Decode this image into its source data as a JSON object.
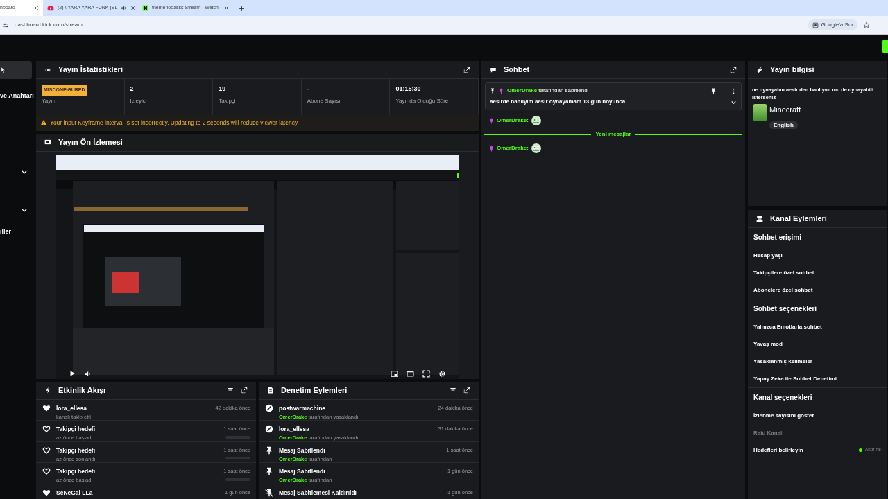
{
  "browser": {
    "tabs": [
      {
        "title": "hboard",
        "kind": "plain",
        "selected": true
      },
      {
        "title": "(2) //YARA YARA FUNK (SL",
        "kind": "video",
        "selected": false
      },
      {
        "title": "themeriodasss Stream - Watch",
        "kind": "kick",
        "selected": false
      }
    ],
    "url": "dashboard.kick.com/stream",
    "lens_button": "Google'a Sor"
  },
  "sidebar": {
    "items": [
      {
        "kind": "blank",
        "selected": true
      },
      {
        "kind": "text",
        "label": "ve Anahtarı",
        "selected": false
      },
      {
        "kind": "chevron",
        "selected": false
      },
      {
        "kind": "chevron",
        "selected": false
      },
      {
        "kind": "text",
        "label": "iller",
        "selected": false
      }
    ]
  },
  "stats": {
    "title": "Yayın İstatistikleri",
    "status_badge": "MISCONFIGURED",
    "items": [
      {
        "label": "Yayın"
      },
      {
        "value": "2",
        "label": "İzleyici"
      },
      {
        "value": "19",
        "label": "Takipçi"
      },
      {
        "value": "-",
        "label": "Abone Sayısı"
      },
      {
        "value": "01:15:30",
        "label": "Yayında Olduğu Süre"
      }
    ],
    "warning": "Your input Keyframe interval is set incorrectly. Updating to 2 seconds will reduce viewer latency."
  },
  "preview": {
    "title": "Yayın Ön İzlemesi"
  },
  "activity": {
    "title": "Etkinlik Akışı",
    "items": [
      {
        "kind": "follow",
        "title": "lora_ellesa",
        "subtitle": "kanalı takip etti",
        "time": "42 dakika önce"
      },
      {
        "kind": "goal",
        "title": "Takipçi hedefi",
        "subtitle": "az önce başladı",
        "time": "1 saat önce",
        "level": 0
      },
      {
        "kind": "goal",
        "title": "Takipçi hedefi",
        "subtitle": "az önce sonlandı",
        "time": "1 saat önce",
        "level": 0
      },
      {
        "kind": "goal",
        "title": "Takipçi hedefi",
        "subtitle": "az önce başladı",
        "time": "1 saat önce",
        "level": 0
      },
      {
        "kind": "follow",
        "title": "SeNeGal LLa",
        "time": "1 gün önce"
      }
    ]
  },
  "moderation": {
    "title": "Denetim Eylemleri",
    "items": [
      {
        "kind": "ban",
        "title": "postwarmachine",
        "actor": "OmerDrake",
        "detail": "tarafından yasaklandı",
        "time": "24 dakika önce"
      },
      {
        "kind": "ban",
        "title": "lora_ellesa",
        "actor": "OmerDrake",
        "detail": "tarafından yasaklandı",
        "time": "31 dakika önce"
      },
      {
        "kind": "pin",
        "title": "Mesaj Sabitlendi",
        "actor": "OmerDrake",
        "detail": "tarafından",
        "time": "1 saat önce"
      },
      {
        "kind": "pin",
        "title": "Mesaj Sabitlendi",
        "actor": "OmerDrake",
        "detail": "tarafından",
        "time": "1 gün önce"
      },
      {
        "kind": "unpin",
        "title": "Mesaj Sabitlemesi Kaldırıldı",
        "time": "1 gün önce"
      }
    ]
  },
  "chat": {
    "title": "Sohbet",
    "pinned": {
      "user": "OmerDrake",
      "suffix": "tarafından sabitlendi",
      "text": "aesirde banlıyım aesir oynayamam 13 gün boyunca"
    },
    "messages": [
      {
        "kind": "message",
        "user": "OmerDrake:"
      },
      {
        "kind": "divider",
        "label": "Yeni mesajlar"
      },
      {
        "kind": "message",
        "user": "OmerDrake:"
      }
    ]
  },
  "info": {
    "title": "Yayın bilgisi",
    "description_lines": [
      "ne oynayalım aesir den banlıyım mc de oynayabili",
      "isterseniz"
    ],
    "category": "Minecraft",
    "language": "English"
  },
  "actions": {
    "title": "Kanal Eylemleri",
    "sections": [
      {
        "heading": "Sohbet erişimi",
        "items": [
          {
            "label": "Hesap yaşı",
            "disabled": false
          },
          {
            "label": "Takipçilere özel sohbet",
            "disabled": false
          },
          {
            "label": "Abonelere özel sohbet",
            "disabled": false
          }
        ]
      },
      {
        "heading": "Sohbet seçenekleri",
        "items": [
          {
            "label": "Yalnızca Emotlarla sohbet",
            "disabled": false
          },
          {
            "label": "Yavaş mod",
            "disabled": false
          },
          {
            "label": "Yasaklanmış kelimeler",
            "disabled": false
          },
          {
            "label": "Yapay Zeka ile Sohbet Denetimi",
            "disabled": false
          }
        ]
      },
      {
        "heading": "Kanal seçenekleri",
        "items": [
          {
            "label": "İzlenme sayısını göster",
            "disabled": false
          },
          {
            "label": "Raid Kanalı",
            "disabled": true
          },
          {
            "label": "Hedefleri belirleyin",
            "disabled": false,
            "status": "Aktif he"
          }
        ]
      }
    ]
  }
}
